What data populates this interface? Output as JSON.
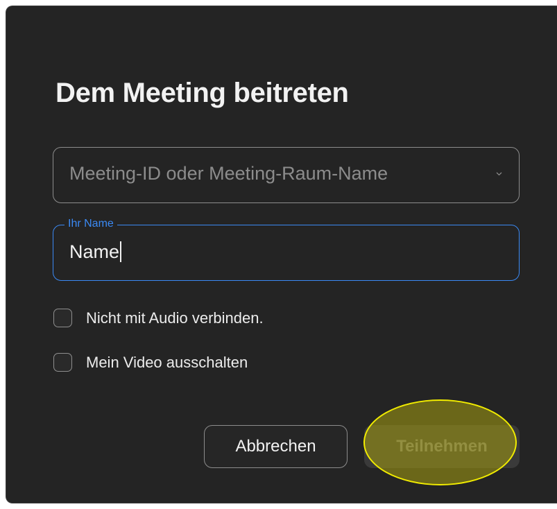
{
  "dialog": {
    "title": "Dem Meeting beitreten"
  },
  "meeting_field": {
    "placeholder": "Meeting-ID oder Meeting-Raum-Name",
    "value": "",
    "icon": "chevron-down-icon"
  },
  "name_field": {
    "label": "Ihr Name",
    "value": "Name"
  },
  "options": [
    {
      "label": "Nicht mit Audio verbinden.",
      "checked": false
    },
    {
      "label": "Mein Video ausschalten",
      "checked": false
    }
  ],
  "buttons": {
    "cancel_label": "Abbrechen",
    "join_label": "Teilnehmen",
    "join_enabled": false
  },
  "colors": {
    "background": "#242424",
    "accent": "#3b8af5",
    "highlight": "#f1ec00"
  }
}
